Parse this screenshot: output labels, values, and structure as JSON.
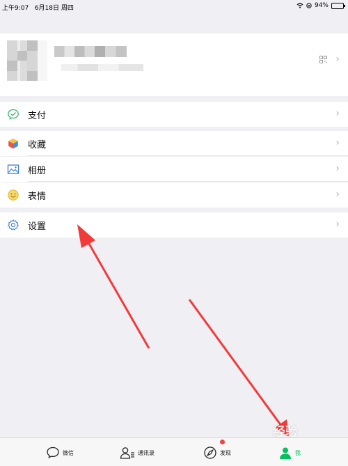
{
  "status_bar": {
    "time": "上午9:07",
    "date": "6月18日 周四",
    "battery": "94%"
  },
  "menu": [
    {
      "label": "支付"
    },
    {
      "label": "收藏"
    },
    {
      "label": "相册"
    },
    {
      "label": "表情"
    },
    {
      "label": "设置"
    }
  ],
  "tabs": [
    {
      "label": "微信"
    },
    {
      "label": "通讯录"
    },
    {
      "label": "发现"
    },
    {
      "label": "我"
    }
  ],
  "colors": {
    "accent_green": "#07c160",
    "annotation_red": "#f23a3a",
    "background": "#efeff4"
  },
  "watermark": "经验"
}
